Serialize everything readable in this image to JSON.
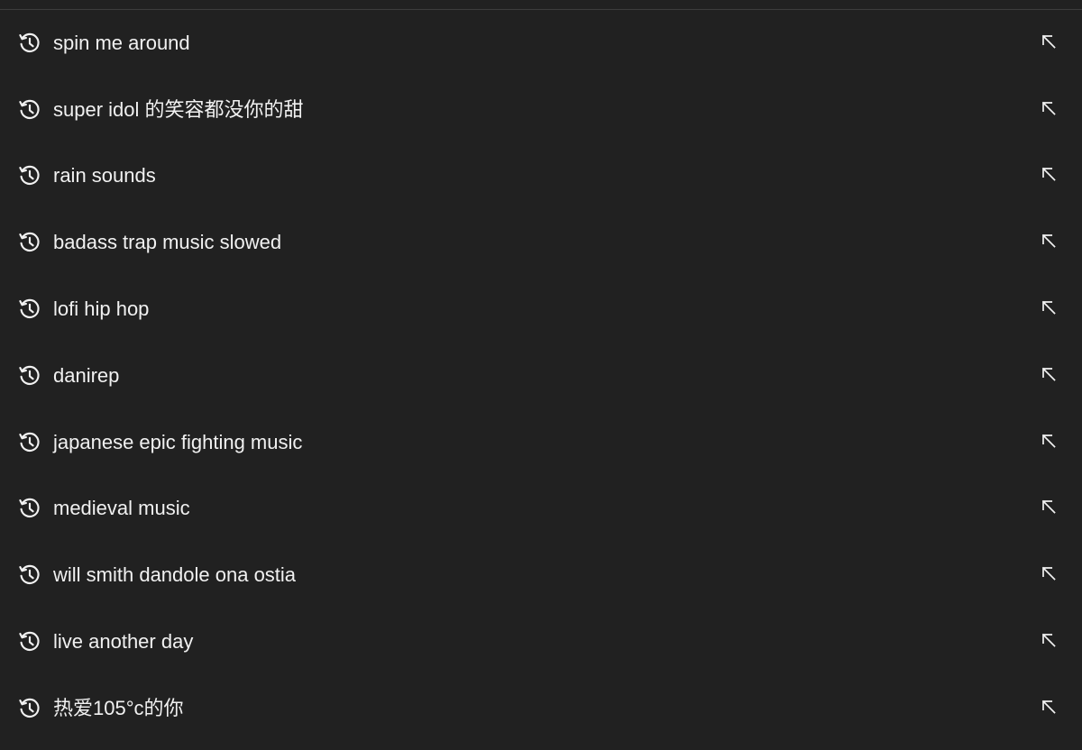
{
  "search_history": {
    "items": [
      {
        "query": "spin me around",
        "icon": "history-icon",
        "action_icon": "arrow-up-left-icon"
      },
      {
        "query": "super idol 的笑容都没你的甜",
        "icon": "history-icon",
        "action_icon": "arrow-up-left-icon"
      },
      {
        "query": "rain sounds",
        "icon": "history-icon",
        "action_icon": "arrow-up-left-icon"
      },
      {
        "query": "badass trap music slowed",
        "icon": "history-icon",
        "action_icon": "arrow-up-left-icon"
      },
      {
        "query": "lofi hip hop",
        "icon": "history-icon",
        "action_icon": "arrow-up-left-icon"
      },
      {
        "query": "danirep",
        "icon": "history-icon",
        "action_icon": "arrow-up-left-icon"
      },
      {
        "query": "japanese epic fighting music",
        "icon": "history-icon",
        "action_icon": "arrow-up-left-icon"
      },
      {
        "query": "medieval music",
        "icon": "history-icon",
        "action_icon": "arrow-up-left-icon"
      },
      {
        "query": "will smith dandole ona ostia",
        "icon": "history-icon",
        "action_icon": "arrow-up-left-icon"
      },
      {
        "query": "live another day",
        "icon": "history-icon",
        "action_icon": "arrow-up-left-icon"
      },
      {
        "query": "热爱105°c的你",
        "icon": "history-icon",
        "action_icon": "arrow-up-left-icon"
      }
    ]
  },
  "colors": {
    "background": "#212121",
    "text": "#f1f1f1",
    "icon": "#f1f1f1",
    "divider": "#3d3d3d"
  }
}
